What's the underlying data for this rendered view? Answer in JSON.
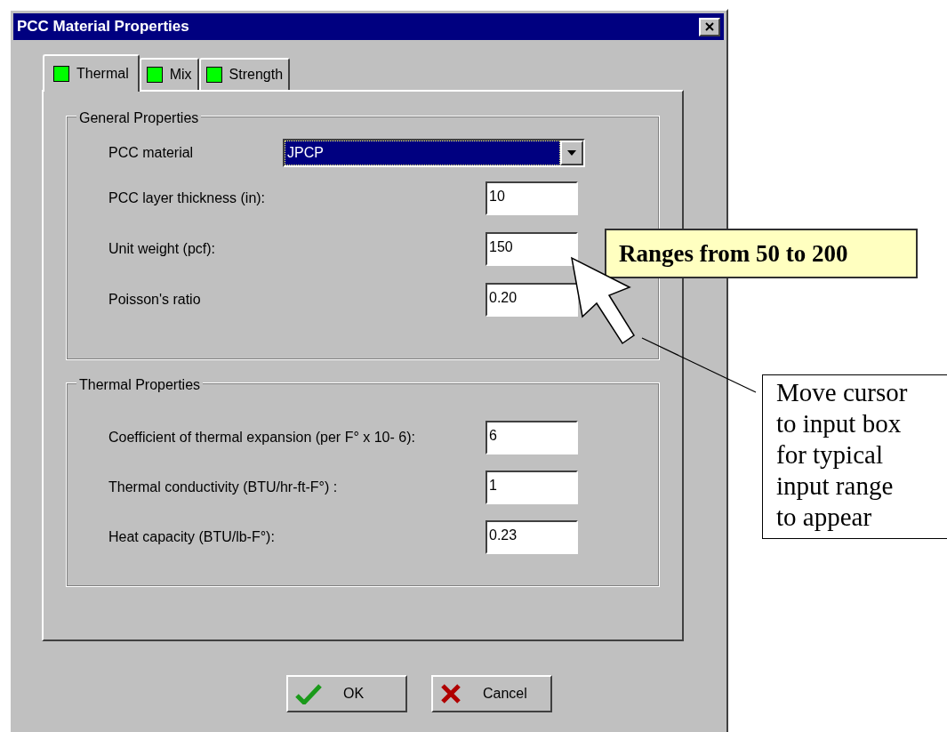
{
  "window": {
    "title": "PCC Material Properties"
  },
  "tabs": [
    {
      "label": "Thermal",
      "selected": true
    },
    {
      "label": "Mix",
      "selected": false
    },
    {
      "label": "Strength",
      "selected": false
    }
  ],
  "groups": [
    {
      "title": "General Properties",
      "fields": [
        {
          "kind": "dropdown",
          "label": "PCC material",
          "value": "JPCP",
          "focused": true
        },
        {
          "kind": "text",
          "label": "PCC layer thickness (in):",
          "value": "10",
          "focused": false
        },
        {
          "kind": "text",
          "label": "Unit weight (pcf):",
          "value": "150",
          "focused": false
        },
        {
          "kind": "text",
          "label": "Poisson's ratio",
          "value": "0.20",
          "focused": false
        }
      ]
    },
    {
      "title": "Thermal Properties",
      "fields": [
        {
          "kind": "text",
          "label": "Coefficient of thermal expansion (per F° x 10- 6):",
          "value": "6",
          "focused": false
        },
        {
          "kind": "text",
          "label": "Thermal conductivity (BTU/hr-ft-F°) :",
          "value": "1",
          "focused": false
        },
        {
          "kind": "text",
          "label": "Heat capacity (BTU/lb-F°):",
          "value": "0.23",
          "focused": false
        }
      ]
    }
  ],
  "buttons": [
    {
      "kind": "ok",
      "label": "OK"
    },
    {
      "kind": "cancel",
      "label": "Cancel"
    }
  ],
  "annotations": [
    {
      "kind": "tooltip",
      "lines": [
        "Ranges from 50 to 200"
      ]
    },
    {
      "kind": "note",
      "lines": [
        "Move cursor",
        "to input box",
        "for typical",
        "input range",
        "to appear"
      ]
    }
  ]
}
